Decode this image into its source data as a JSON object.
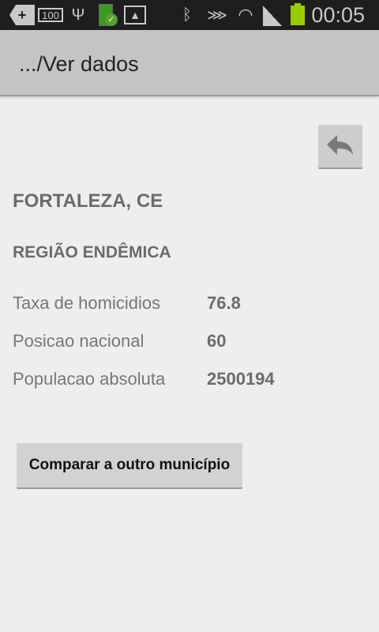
{
  "status_bar": {
    "time": "00:05",
    "notification_badge": "100",
    "icons": [
      "add-notification-icon",
      "battery-100-icon",
      "usb-icon",
      "battery-charged-icon",
      "image-icon",
      "bluetooth-icon",
      "mute-icon",
      "wifi-icon",
      "signal-icon",
      "battery-icon"
    ],
    "battery_color": "#99cc00"
  },
  "action_bar": {
    "title": ".../Ver dados"
  },
  "content": {
    "city": "FORTALEZA, CE",
    "region": "REGIÃO ENDÊMICA",
    "stats": [
      {
        "label": "Taxa de homicidios",
        "value": "76.8"
      },
      {
        "label": "Posicao nacional",
        "value": "60"
      },
      {
        "label": "Populacao absoluta",
        "value": "2500194"
      }
    ],
    "compare_button": "Comparar a outro município"
  }
}
